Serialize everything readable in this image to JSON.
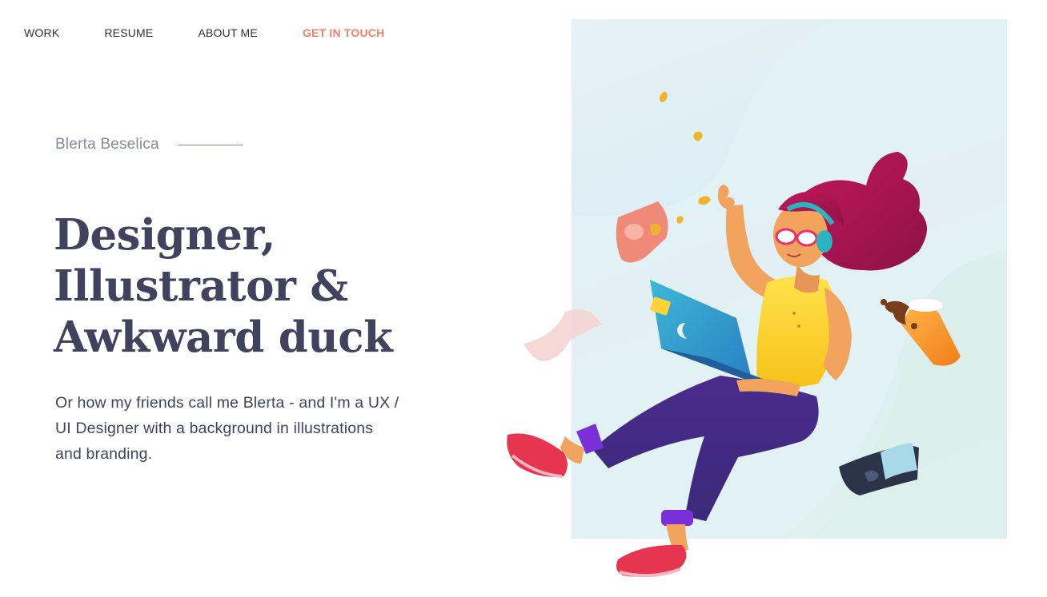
{
  "nav": {
    "items": [
      {
        "label": "WORK"
      },
      {
        "label": "RESUME"
      },
      {
        "label": "ABOUT ME"
      },
      {
        "label": "GET IN TOUCH"
      }
    ]
  },
  "hero": {
    "eyebrow_name": "Blerta Beselica",
    "headline": [
      "Designer,",
      "Illustrator &",
      "Awkward duck"
    ],
    "lede": "Or how my friends call me Blerta - and I'm a UX / UI Designer with a background in illustrations and branding."
  },
  "colors": {
    "accent": "#f0826a",
    "heading": "#43425e",
    "muted": "#8a8aa2",
    "panel": "#e3f0f3"
  },
  "illustration": {
    "icon": "woman-with-laptop-illustration"
  }
}
